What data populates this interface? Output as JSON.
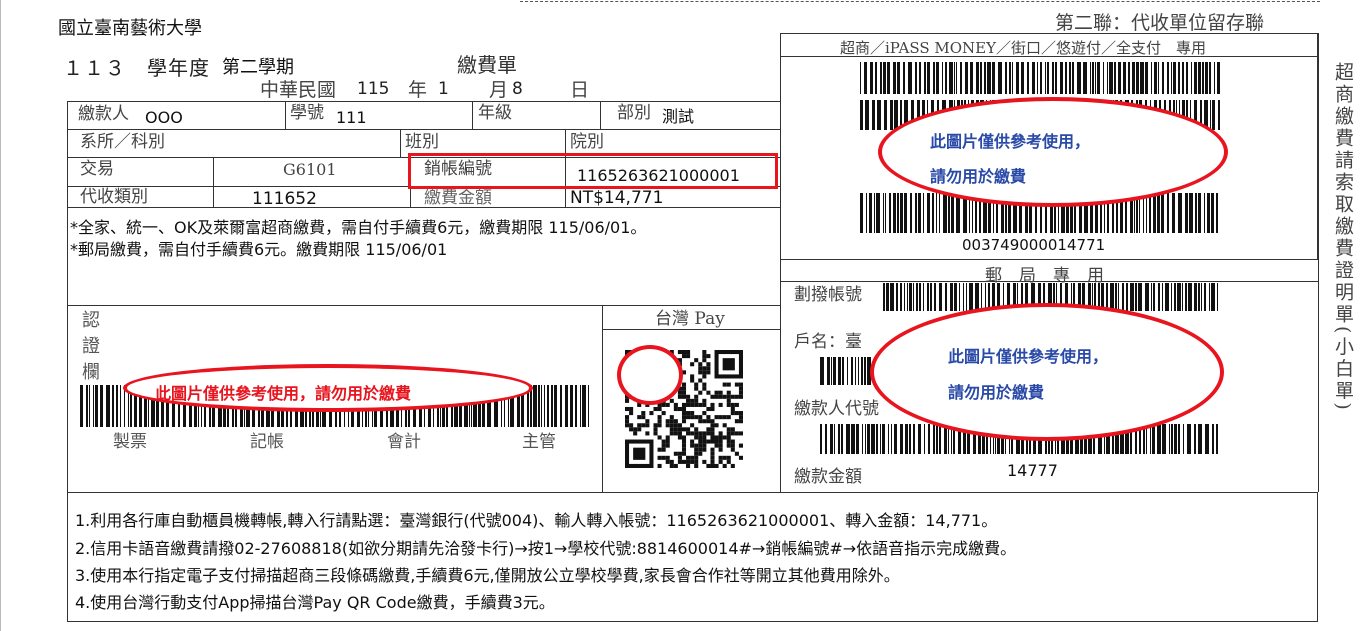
{
  "school_name": "國立臺南藝術大學",
  "copy_label": "第二聯：代收單位留存聯",
  "term": {
    "year_label": "１１３　學年度",
    "semester": "第二學期",
    "bill_title": "繳費單"
  },
  "date_line": {
    "era": "中華民國",
    "year": "115",
    "year_unit": "年",
    "month": "1",
    "month_unit": "月",
    "day": "8",
    "day_unit": "日"
  },
  "form": {
    "payer_label": "繳款人",
    "payer_value": "OOO",
    "student_no_label": "學號",
    "student_no_value": "111",
    "grade_label": "年級",
    "dept_label": "部別",
    "dept_value": "測試",
    "department_label": "系所／科別",
    "class_label": "班別",
    "college_label": "院別",
    "trans_label": "交易",
    "trans_value": "G6101",
    "account_label": "銷帳編號",
    "account_value": "1165263621000001",
    "agency_label": "代收類別",
    "agency_value": "111652",
    "amount_label": "繳費金額",
    "amount_value": "NT$14,771"
  },
  "fee_notes": [
    "*全家、統一、OK及萊爾富超商繳費，需自付手續費6元，繳費期限 115/06/01。",
    "*郵局繳費，需自付手續費6元。繳費期限 115/06/01"
  ],
  "cert": {
    "label_chars": [
      "認",
      "證",
      "欄"
    ],
    "signatures": [
      "製票",
      "記帳",
      "會計",
      "主管"
    ],
    "notice": "此圖片僅供參考使用，請勿用於繳費"
  },
  "taiwan_pay": {
    "title": "台灣 Pay"
  },
  "store": {
    "header": "超商／iPASS MONEY／街口／悠遊付／全支付　專用",
    "barcode_number": "003749000014771",
    "notice_line1": "此圖片僅供參考使用，",
    "notice_line2": "請勿用於繳費"
  },
  "post": {
    "header": "郵　局　專　用",
    "transfer_label": "劃撥帳號",
    "name_label": "戶名：臺",
    "payer_code_label": "繳款人代號",
    "amount_label": "繳款金額",
    "amount_value": "14777",
    "notice_line1": "此圖片僅供參考使用，",
    "notice_line2": "請勿用於繳費"
  },
  "side_title": "超商繳費請索取繳費證明單(小白單)",
  "instructions": [
    "1.利用各行庫自動櫃員機轉帳,轉入行請點選：臺灣銀行(代號004)、輸人轉入帳號：1165263621000001、轉入金額：14,771。",
    "2.信用卡語音繳費請撥02-27608818(如欲分期請先洽發卡行)→按1→學校代號:8814600014#→銷帳編號#→依語音指示完成繳費。",
    "3.使用本行指定電子支付掃描超商三段條碼繳費,手續費6元,僅開放公立學校學費,家長會合作社等開立其他費用除外。",
    "4.使用台灣行動支付App掃描台灣Pay QR Code繳費，手續費3元。"
  ],
  "colors": {
    "highlight_red": "#e8141e",
    "notice_blue": "#2a4aa8"
  }
}
